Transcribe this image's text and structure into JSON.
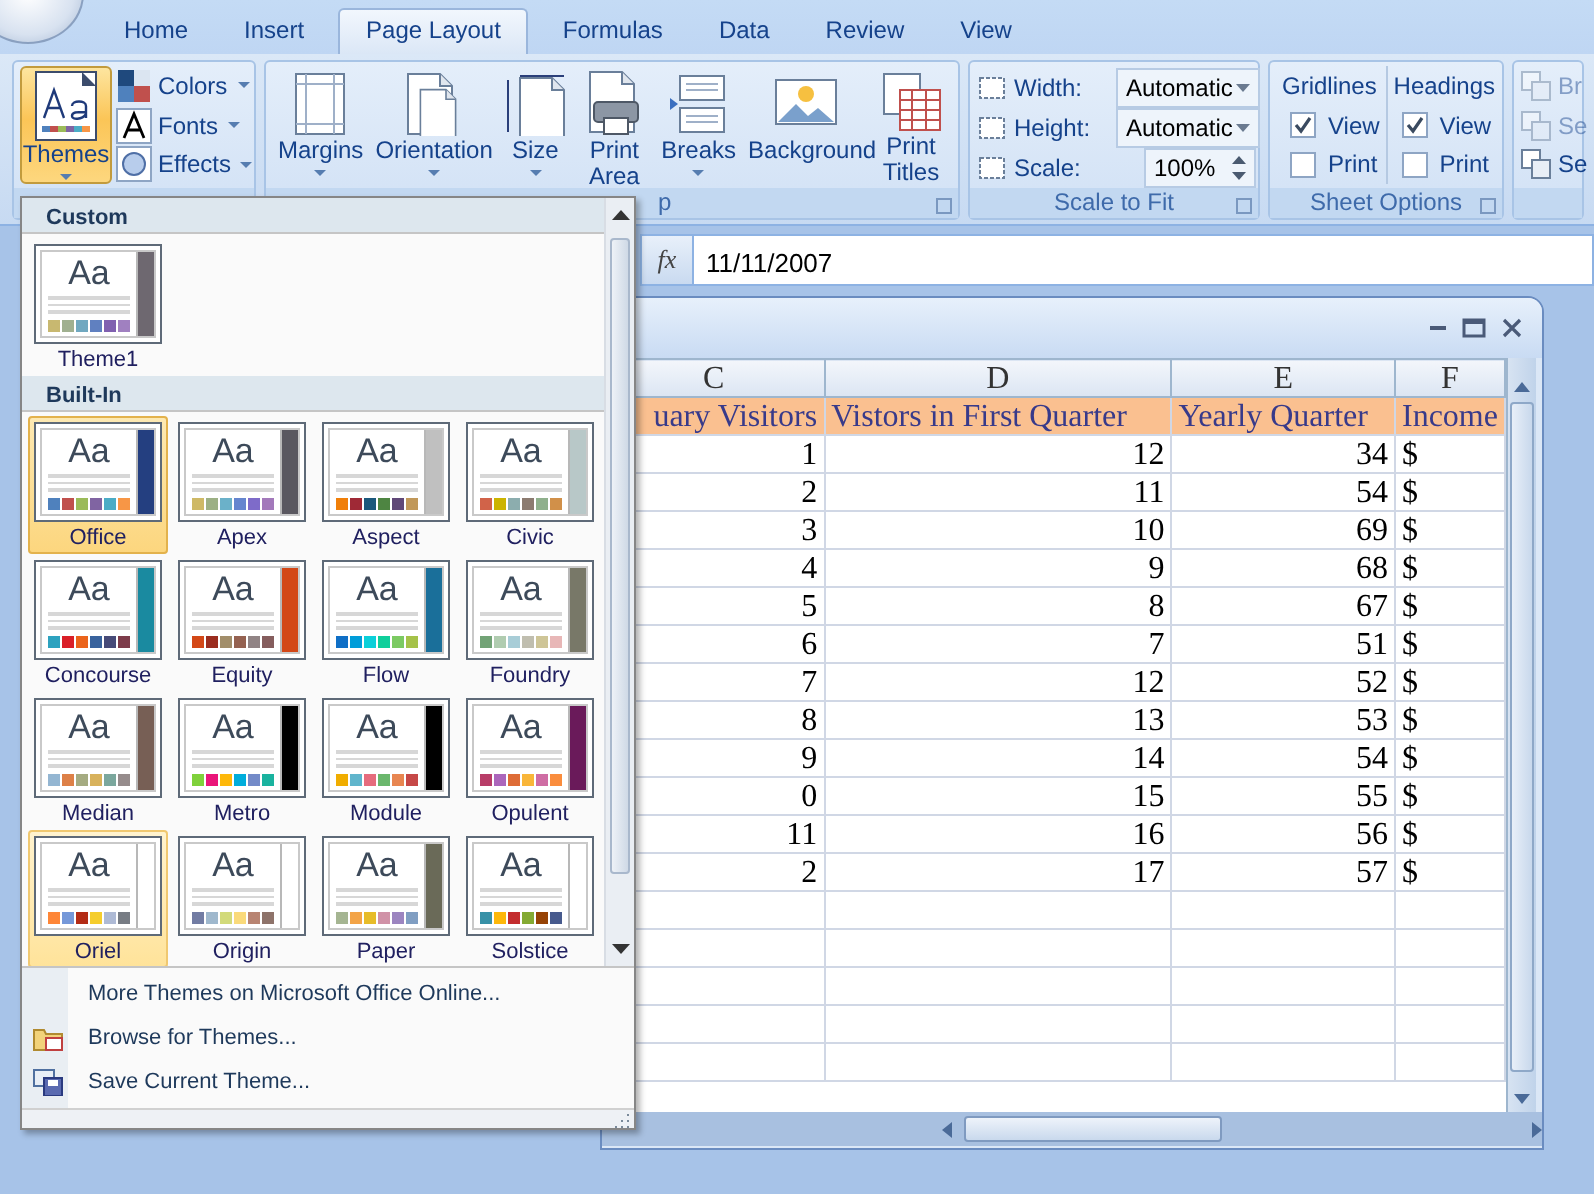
{
  "tabs": [
    {
      "label": "Home",
      "selected": false
    },
    {
      "label": "Insert",
      "selected": false
    },
    {
      "label": "Page Layout",
      "selected": true
    },
    {
      "label": "Formulas",
      "selected": false
    },
    {
      "label": "Data",
      "selected": false
    },
    {
      "label": "Review",
      "selected": false
    },
    {
      "label": "View",
      "selected": false
    }
  ],
  "ribbon": {
    "themes_group": {
      "main": {
        "label": "Themes",
        "pressed": true
      },
      "items": [
        {
          "label": "Colors",
          "kind": "colors"
        },
        {
          "label": "Fonts",
          "kind": "fonts"
        },
        {
          "label": "Effects",
          "kind": "effects"
        }
      ]
    },
    "page_setup": {
      "label": "p",
      "buttons": [
        {
          "label": "Margins",
          "kind": "margins"
        },
        {
          "label": "Orientation",
          "kind": "orientation"
        },
        {
          "label": "Size",
          "kind": "size"
        },
        {
          "label": "Print Area",
          "kind": "printarea"
        },
        {
          "label": "Breaks",
          "kind": "breaks"
        },
        {
          "label": "Background",
          "kind": "background"
        },
        {
          "label": "Print Titles",
          "kind": "printtitles"
        }
      ]
    },
    "scale_to_fit": {
      "label": "Scale to Fit",
      "fields": [
        {
          "label": "Width:",
          "value": "Automatic",
          "kind": "dropdown"
        },
        {
          "label": "Height:",
          "value": "Automatic",
          "kind": "dropdown"
        },
        {
          "label": "Scale:",
          "value": "100%",
          "kind": "spinner"
        }
      ]
    },
    "sheet_options": {
      "label": "Sheet Options",
      "sets": [
        {
          "title": "Gridlines",
          "options": [
            {
              "label": "View",
              "checked": true
            },
            {
              "label": "Print",
              "checked": false
            }
          ]
        },
        {
          "title": "Headings",
          "options": [
            {
              "label": "View",
              "checked": true
            },
            {
              "label": "Print",
              "checked": false
            }
          ]
        }
      ]
    },
    "arrange": {
      "items": [
        {
          "label": "Br",
          "disabled": true
        },
        {
          "label": "Se",
          "disabled": true
        },
        {
          "label": "Se",
          "disabled": false
        }
      ]
    }
  },
  "formula_bar": {
    "fx": "fx",
    "value": "11/11/2007"
  },
  "themes_menu": {
    "sections": [
      {
        "title": "Custom",
        "themes": [
          {
            "name": "Theme1",
            "preview_text": "Aa",
            "selected": false,
            "hovered": false,
            "color": "#6e6870",
            "swatches": [
              {
                "color": "#c8b870"
              },
              {
                "color": "#a0b090"
              },
              {
                "color": "#70a8c0"
              },
              {
                "color": "#6080c0"
              },
              {
                "color": "#8060b0"
              },
              {
                "color": "#a080c0"
              }
            ]
          }
        ]
      },
      {
        "title": "Built-In",
        "themes": [
          {
            "name": "Office",
            "preview_text": "Aa",
            "selected": true,
            "hovered": false,
            "color": "#243f80",
            "swatches": [
              {
                "color": "#4f81bd"
              },
              {
                "color": "#c0504d"
              },
              {
                "color": "#9bbb59"
              },
              {
                "color": "#8064a2"
              },
              {
                "color": "#4bacc6"
              },
              {
                "color": "#f79646"
              }
            ]
          },
          {
            "name": "Apex",
            "preview_text": "Aa",
            "selected": false,
            "hovered": false,
            "color": "#5a5860",
            "swatches": [
              {
                "color": "#ceb966"
              },
              {
                "color": "#9cb084"
              },
              {
                "color": "#6bb1c9"
              },
              {
                "color": "#6585cf"
              },
              {
                "color": "#7e6bc9"
              },
              {
                "color": "#a379bb"
              }
            ]
          },
          {
            "name": "Aspect",
            "preview_text": "Aa",
            "selected": false,
            "hovered": false,
            "color": "#c0c0c0",
            "swatches": [
              {
                "color": "#f07f09"
              },
              {
                "color": "#9f2936"
              },
              {
                "color": "#1b587c"
              },
              {
                "color": "#4e8542"
              },
              {
                "color": "#604878"
              },
              {
                "color": "#c19859"
              }
            ]
          },
          {
            "name": "Civic",
            "preview_text": "Aa",
            "selected": false,
            "hovered": false,
            "color": "#b8c8c8",
            "swatches": [
              {
                "color": "#d16349"
              },
              {
                "color": "#ccb400"
              },
              {
                "color": "#8cadae"
              },
              {
                "color": "#8c7b70"
              },
              {
                "color": "#8fb08c"
              },
              {
                "color": "#d19049"
              }
            ]
          },
          {
            "name": "Concourse",
            "preview_text": "Aa",
            "selected": false,
            "hovered": false,
            "color": "#1a8aa0",
            "swatches": [
              {
                "color": "#2da2bf"
              },
              {
                "color": "#da1f28"
              },
              {
                "color": "#eb641b"
              },
              {
                "color": "#39639d"
              },
              {
                "color": "#474b78"
              },
              {
                "color": "#7d3c4a"
              }
            ]
          },
          {
            "name": "Equity",
            "preview_text": "Aa",
            "selected": false,
            "hovered": false,
            "color": "#d34817",
            "swatches": [
              {
                "color": "#d34817"
              },
              {
                "color": "#9b2d1f"
              },
              {
                "color": "#a28e6a"
              },
              {
                "color": "#956251"
              },
              {
                "color": "#918485"
              },
              {
                "color": "#855d5d"
              }
            ]
          },
          {
            "name": "Flow",
            "preview_text": "Aa",
            "selected": false,
            "hovered": false,
            "color": "#1a6f9a",
            "swatches": [
              {
                "color": "#0f6fc6"
              },
              {
                "color": "#009dd9"
              },
              {
                "color": "#0bd0d9"
              },
              {
                "color": "#10cf9b"
              },
              {
                "color": "#7cca62"
              },
              {
                "color": "#a5c249"
              }
            ]
          },
          {
            "name": "Foundry",
            "preview_text": "Aa",
            "selected": false,
            "hovered": false,
            "color": "#787868",
            "swatches": [
              {
                "color": "#72a376"
              },
              {
                "color": "#b0ccb0"
              },
              {
                "color": "#a8cdd7"
              },
              {
                "color": "#c0beaf"
              },
              {
                "color": "#cec597"
              },
              {
                "color": "#e8b7b7"
              }
            ]
          },
          {
            "name": "Median",
            "preview_text": "Aa",
            "selected": false,
            "hovered": false,
            "color": "#775f55",
            "swatches": [
              {
                "color": "#94b6d2"
              },
              {
                "color": "#dd8047"
              },
              {
                "color": "#a5ab81"
              },
              {
                "color": "#d8b25c"
              },
              {
                "color": "#7ba79d"
              },
              {
                "color": "#968c8c"
              }
            ]
          },
          {
            "name": "Metro",
            "preview_text": "Aa",
            "selected": false,
            "hovered": false,
            "color": "#000000",
            "swatches": [
              {
                "color": "#7fd13b"
              },
              {
                "color": "#ea157a"
              },
              {
                "color": "#feb80a"
              },
              {
                "color": "#00addc"
              },
              {
                "color": "#738ac8"
              },
              {
                "color": "#1ab39f"
              }
            ]
          },
          {
            "name": "Module",
            "preview_text": "Aa",
            "selected": false,
            "hovered": false,
            "color": "#000000",
            "swatches": [
              {
                "color": "#f0ad00"
              },
              {
                "color": "#60b5cc"
              },
              {
                "color": "#e66c7d"
              },
              {
                "color": "#6bb76d"
              },
              {
                "color": "#e88651"
              },
              {
                "color": "#c64847"
              }
            ]
          },
          {
            "name": "Opulent",
            "preview_text": "Aa",
            "selected": false,
            "hovered": false,
            "color": "#6a1a5a",
            "swatches": [
              {
                "color": "#b83d68"
              },
              {
                "color": "#ac66bb"
              },
              {
                "color": "#de6c36"
              },
              {
                "color": "#f9b639"
              },
              {
                "color": "#cf6da4"
              },
              {
                "color": "#fa8d3d"
              }
            ]
          },
          {
            "name": "Oriel",
            "preview_text": "Aa",
            "selected": false,
            "hovered": true,
            "color": "#ffffff",
            "swatches": [
              {
                "color": "#fe8637"
              },
              {
                "color": "#7598d9"
              },
              {
                "color": "#b32c16"
              },
              {
                "color": "#f5cd2d"
              },
              {
                "color": "#aebad5"
              },
              {
                "color": "#777c84"
              }
            ]
          },
          {
            "name": "Origin",
            "preview_text": "Aa",
            "selected": false,
            "hovered": false,
            "color": "#ffffff",
            "swatches": [
              {
                "color": "#727ca3"
              },
              {
                "color": "#9fb8cd"
              },
              {
                "color": "#d2da7a"
              },
              {
                "color": "#fada7a"
              },
              {
                "color": "#b88472"
              },
              {
                "color": "#8e736a"
              }
            ]
          },
          {
            "name": "Paper",
            "preview_text": "Aa",
            "selected": false,
            "hovered": false,
            "color": "#6a6a58",
            "swatches": [
              {
                "color": "#a5b592"
              },
              {
                "color": "#f3a447"
              },
              {
                "color": "#e7bc29"
              },
              {
                "color": "#d092a7"
              },
              {
                "color": "#9c85c0"
              },
              {
                "color": "#809ec2"
              }
            ]
          },
          {
            "name": "Solstice",
            "preview_text": "Aa",
            "selected": false,
            "hovered": false,
            "color": "#ffffff",
            "swatches": [
              {
                "color": "#3891a7"
              },
              {
                "color": "#feb80a"
              },
              {
                "color": "#c32d2e"
              },
              {
                "color": "#84aa33"
              },
              {
                "color": "#964305"
              },
              {
                "color": "#475a8d"
              }
            ]
          }
        ]
      }
    ],
    "commands": [
      {
        "label": "More Themes on Microsoft Office Online...",
        "kind": "online"
      },
      {
        "label": "Browse for Themes...",
        "kind": "browse"
      },
      {
        "label": "Save Current Theme...",
        "kind": "save"
      }
    ]
  },
  "sheet": {
    "columns": [
      {
        "letter": "C",
        "header": "uary Visitors"
      },
      {
        "letter": "D",
        "header": "Vistors in First Quarter"
      },
      {
        "letter": "E",
        "header": "Yearly Quarter"
      },
      {
        "letter": "F",
        "header": "Income"
      }
    ],
    "rows": [
      [
        "1",
        "12",
        "34",
        "$"
      ],
      [
        "2",
        "11",
        "54",
        "$"
      ],
      [
        "3",
        "10",
        "69",
        "$"
      ],
      [
        "4",
        "9",
        "68",
        "$"
      ],
      [
        "5",
        "8",
        "67",
        "$"
      ],
      [
        "6",
        "7",
        "51",
        "$"
      ],
      [
        "7",
        "12",
        "52",
        "$"
      ],
      [
        "8",
        "13",
        "53",
        "$"
      ],
      [
        "9",
        "14",
        "54",
        "$"
      ],
      [
        "0",
        "15",
        "55",
        "$"
      ],
      [
        "11",
        "16",
        "56",
        "$"
      ],
      [
        "2",
        "17",
        "57",
        "$"
      ]
    ]
  }
}
